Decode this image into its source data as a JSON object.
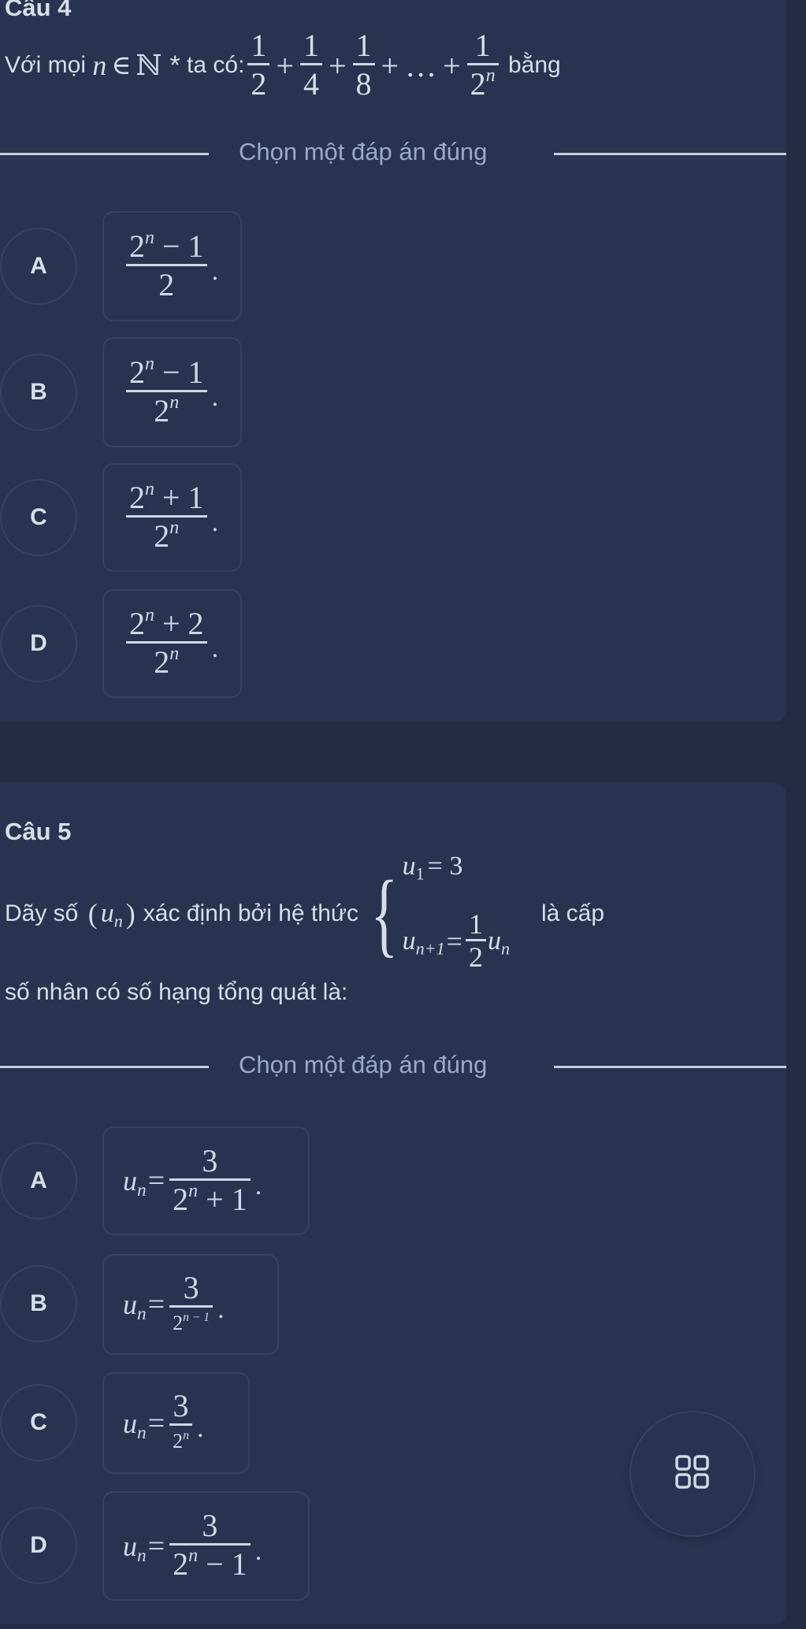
{
  "questions": [
    {
      "title": "Câu 4",
      "prompt_prefix": "Với mọi",
      "prompt_var": "n",
      "prompt_in": "∈",
      "prompt_set": "ℕ",
      "prompt_star": "*",
      "prompt_mid": "ta có:",
      "series": {
        "terms": [
          {
            "num": "1",
            "den": "2"
          },
          {
            "num": "1",
            "den": "4"
          },
          {
            "num": "1",
            "den": "8"
          }
        ],
        "plus": "+",
        "ellipsis": "…",
        "last": {
          "num": "1",
          "den_base": "2",
          "den_exp": "n"
        }
      },
      "prompt_suffix": "bằng",
      "instruction": "Chọn một đáp án đúng",
      "options": [
        {
          "letter": "A",
          "num_base": "2",
          "num_exp": "n",
          "num_rest": " − 1",
          "den": "2",
          "den_exp": "",
          "end": "."
        },
        {
          "letter": "B",
          "num_base": "2",
          "num_exp": "n",
          "num_rest": " − 1",
          "den": "2",
          "den_exp": "n",
          "end": "."
        },
        {
          "letter": "C",
          "num_base": "2",
          "num_exp": "n",
          "num_rest": " + 1",
          "den": "2",
          "den_exp": "n",
          "end": "."
        },
        {
          "letter": "D",
          "num_base": "2",
          "num_exp": "n",
          "num_rest": " + 2",
          "den": "2",
          "den_exp": "n",
          "end": "."
        }
      ]
    },
    {
      "title": "Câu 5",
      "prompt_prefix": "Dãy số",
      "seq_open": "(",
      "seq_var": "u",
      "seq_sub": "n",
      "seq_close": ")",
      "prompt_mid": "xác định bởi hệ thức",
      "system": {
        "line1_var": "u",
        "line1_sub": "1",
        "line1_rhs": "= 3",
        "line2_var": "u",
        "line2_sub": "n+1",
        "line2_eq": "=",
        "line2_num": "1",
        "line2_den": "2",
        "line2_tail_var": "u",
        "line2_tail_sub": "n"
      },
      "prompt_suffix": "là cấp",
      "prompt_line2": "số nhân có số hạng tổng quát là:",
      "instruction": "Chọn một đáp án đúng",
      "options": [
        {
          "letter": "A",
          "lhs_var": "u",
          "lhs_sub": "n",
          "eq": "=",
          "num": "3",
          "den_base": "2",
          "den_exp": "n",
          "den_rest": " + 1",
          "end": "."
        },
        {
          "letter": "B",
          "lhs_var": "u",
          "lhs_sub": "n",
          "eq": "=",
          "num": "3",
          "den_base": "2",
          "den_exp": "n − 1",
          "den_rest": "",
          "end": "."
        },
        {
          "letter": "C",
          "lhs_var": "u",
          "lhs_sub": "n",
          "eq": "=",
          "num": "3",
          "den_base": "2",
          "den_exp": "n",
          "den_rest": "",
          "end": "."
        },
        {
          "letter": "D",
          "lhs_var": "u",
          "lhs_sub": "n",
          "eq": "=",
          "num": "3",
          "den_base": "2",
          "den_exp": "n",
          "den_rest": " − 1",
          "end": "."
        }
      ]
    }
  ],
  "fab": {
    "icon": "grid-icon"
  }
}
